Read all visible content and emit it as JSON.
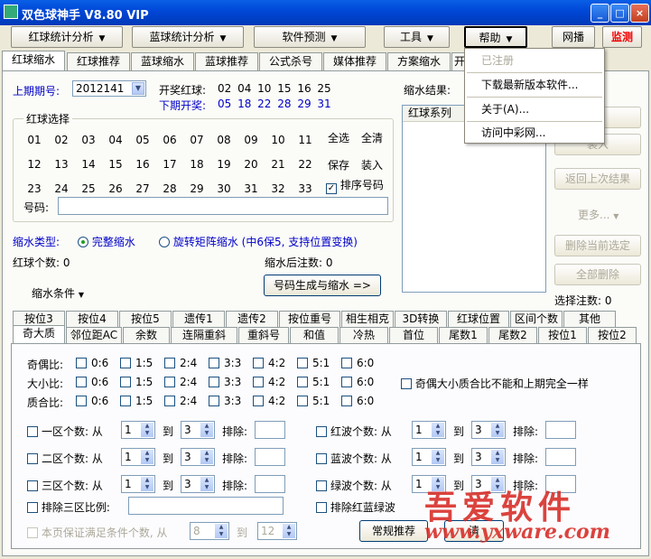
{
  "window": {
    "title": "双色球神手 V8.80 VIP",
    "min": "_",
    "max": "□",
    "close": "×"
  },
  "menubar": {
    "red_analysis": "红球统计分析",
    "blue_analysis": "蓝球统计分析",
    "predict": "软件预测",
    "tools": "工具",
    "help": "帮助",
    "net": "网播",
    "monitor": "监测"
  },
  "tabs": [
    "红球缩水",
    "红球推荐",
    "蓝球缩水",
    "蓝球推荐",
    "公式杀号",
    "媒体推荐",
    "方案缩水",
    "开"
  ],
  "period": {
    "label": "上期期号:",
    "value": "2012141",
    "draw_red_label": "开奖红球:",
    "draw_red": "02 04 10 15 16 25",
    "next_label": "下期开奖:",
    "next_nums": "05 18 22 28 29 31"
  },
  "red_select": {
    "title": "红球选择",
    "numbers": [
      "01",
      "02",
      "03",
      "04",
      "05",
      "06",
      "07",
      "08",
      "09",
      "10",
      "11",
      "12",
      "13",
      "14",
      "15",
      "16",
      "17",
      "18",
      "19",
      "20",
      "21",
      "22",
      "23",
      "24",
      "25",
      "26",
      "27",
      "28",
      "29",
      "30",
      "31",
      "32",
      "33"
    ],
    "select_all": "全选",
    "clear_all": "全清",
    "save": "保存",
    "load": "装入",
    "sort_label": "排序号码",
    "code_label": "号码:"
  },
  "result": {
    "label": "缩水结果:",
    "column": "红球系列",
    "suffix": "果"
  },
  "side_buttons": {
    "b1": "",
    "b2": "装入",
    "b3": "返回上次结果",
    "b4": "更多...",
    "b5": "删除当前选定",
    "b6": "全部删除",
    "select_notes": "选择注数: 0"
  },
  "shrink": {
    "type_label": "缩水类型:",
    "full": "完整缩水",
    "rotate": "旋转矩阵缩水 (中6保5, 支持位置变换)",
    "red_count": "红球个数: 0",
    "after_count": "缩水后注数: 0",
    "condition": "缩水条件",
    "generate": "号码生成与缩水 =>"
  },
  "help_menu": {
    "registered": "已注册",
    "download": "下载最新版本软件...",
    "about": "关于(A)...",
    "visit": "访问中彩网..."
  },
  "cond_tabs_row1": [
    "按位3",
    "按位4",
    "按位5",
    "遗传1",
    "遗传2",
    "按位重号",
    "相生相克",
    "3D转换",
    "红球位置",
    "区间个数",
    "其他"
  ],
  "cond_tabs_row2": [
    "奇大质",
    "邻位距AC",
    "余数",
    "连隔重斜",
    "重斜号",
    "和值",
    "冷热",
    "首位",
    "尾数1",
    "尾数2",
    "按位1",
    "按位2"
  ],
  "ratios": {
    "odd_label": "奇偶比:",
    "big_label": "大小比:",
    "prime_label": "质合比:",
    "opts": [
      "0:6",
      "1:5",
      "2:4",
      "3:3",
      "4:2",
      "5:1",
      "6:0"
    ],
    "note": "奇偶大小质合比不能和上期完全一样"
  },
  "zones": {
    "zone1": "一区个数: 从",
    "zone2": "二区个数: 从",
    "zone3": "三区个数: 从",
    "to": "到",
    "exclude": "排除:",
    "from_val": "1",
    "to_val": "3",
    "red_wave": "红波个数: 从",
    "blue_wave": "蓝波个数: 从",
    "green_wave": "绿波个数: 从",
    "zone_ratio": "排除三区比例:",
    "exclude_rgb": "排除红蓝绿波"
  },
  "bottom": {
    "guarantee": "本页保证满足条件个数, 从",
    "from": "8",
    "to_label": "到",
    "to": "12",
    "recommend": "常规推荐",
    "clear": "清"
  },
  "watermark": {
    "cn": "吾爱软件",
    "url": "www.yxware.com"
  }
}
